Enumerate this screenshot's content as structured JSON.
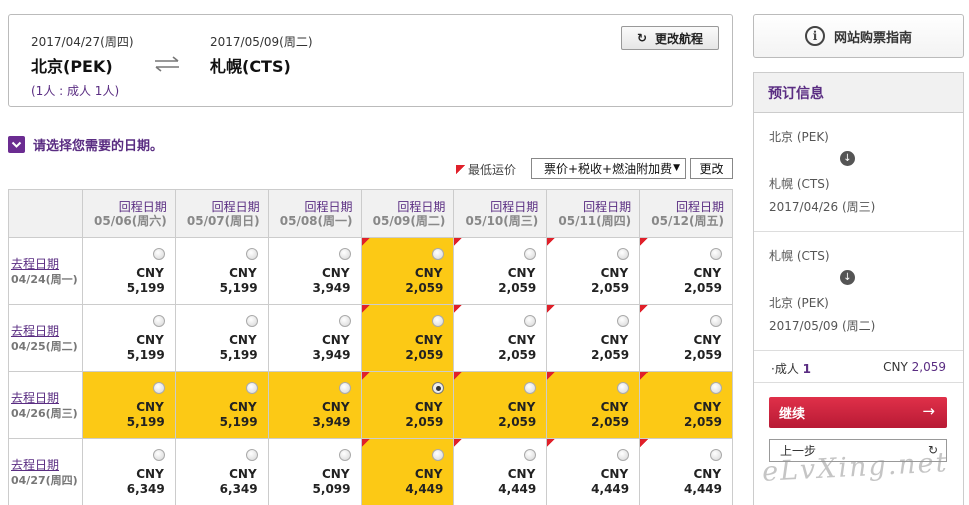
{
  "route": {
    "depart_date": "2017/04/27(周四)",
    "depart_city": "北京(PEK)",
    "return_date": "2017/05/09(周二)",
    "return_city": "札幌(CTS)",
    "passengers": "(1人 : 成人 1人)",
    "change_route_label": "更改航程"
  },
  "select_title": "请选择您需要的日期。",
  "legend_label": "最低运价",
  "price_type_select": "票价+税收+燃油附加费",
  "change_label": "更改",
  "grid": {
    "columns": [
      {
        "label": "回程日期",
        "date": "05/06(周六)"
      },
      {
        "label": "回程日期",
        "date": "05/07(周日)"
      },
      {
        "label": "回程日期",
        "date": "05/08(周一)"
      },
      {
        "label": "回程日期",
        "date": "05/09(周二)"
      },
      {
        "label": "回程日期",
        "date": "05/10(周三)"
      },
      {
        "label": "回程日期",
        "date": "05/11(周四)"
      },
      {
        "label": "回程日期",
        "date": "05/12(周五)"
      }
    ],
    "rows": [
      {
        "label": "去程日期",
        "date": "04/24(周一)",
        "cells": [
          {
            "cur": "CNY",
            "price": "5,199"
          },
          {
            "cur": "CNY",
            "price": "5,199"
          },
          {
            "cur": "CNY",
            "price": "3,949"
          },
          {
            "cur": "CNY",
            "price": "2,059"
          },
          {
            "cur": "CNY",
            "price": "2,059"
          },
          {
            "cur": "CNY",
            "price": "2,059"
          },
          {
            "cur": "CNY",
            "price": "2,059"
          }
        ]
      },
      {
        "label": "去程日期",
        "date": "04/25(周二)",
        "cells": [
          {
            "cur": "CNY",
            "price": "5,199"
          },
          {
            "cur": "CNY",
            "price": "5,199"
          },
          {
            "cur": "CNY",
            "price": "3,949"
          },
          {
            "cur": "CNY",
            "price": "2,059"
          },
          {
            "cur": "CNY",
            "price": "2,059"
          },
          {
            "cur": "CNY",
            "price": "2,059"
          },
          {
            "cur": "CNY",
            "price": "2,059"
          }
        ]
      },
      {
        "label": "去程日期",
        "date": "04/26(周三)",
        "cells": [
          {
            "cur": "CNY",
            "price": "5,199"
          },
          {
            "cur": "CNY",
            "price": "5,199"
          },
          {
            "cur": "CNY",
            "price": "3,949"
          },
          {
            "cur": "CNY",
            "price": "2,059"
          },
          {
            "cur": "CNY",
            "price": "2,059"
          },
          {
            "cur": "CNY",
            "price": "2,059"
          },
          {
            "cur": "CNY",
            "price": "2,059"
          }
        ]
      },
      {
        "label": "去程日期",
        "date": "04/27(周四)",
        "cells": [
          {
            "cur": "CNY",
            "price": "6,349"
          },
          {
            "cur": "CNY",
            "price": "6,349"
          },
          {
            "cur": "CNY",
            "price": "5,099"
          },
          {
            "cur": "CNY",
            "price": "4,449"
          },
          {
            "cur": "CNY",
            "price": "4,449"
          },
          {
            "cur": "CNY",
            "price": "4,449"
          },
          {
            "cur": "CNY",
            "price": "4,449"
          }
        ]
      }
    ]
  },
  "guide_label": "网站购票指南",
  "booking": {
    "title": "预订信息",
    "legs": [
      {
        "from": "北京 (PEK)",
        "to": "札幌 (CTS)",
        "date": "2017/04/26 (周三)"
      },
      {
        "from": "札幌 (CTS)",
        "to": "北京 (PEK)",
        "date": "2017/05/09 (周二)"
      }
    ],
    "pax_label": "·成人",
    "pax_count": "1",
    "total_currency": "CNY",
    "total_amount": "2,059",
    "continue_label": "继续",
    "back_label": "上一步"
  },
  "watermark": "eLvXing.net",
  "colors": {
    "accent_purple": "#5a2d82",
    "highlight_yellow": "#fcc915",
    "cta_red": "#c8213b",
    "fare_flag_red": "#e0202a"
  }
}
